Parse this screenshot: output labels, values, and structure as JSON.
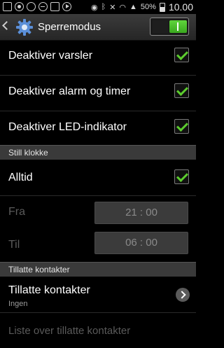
{
  "status_bar": {
    "icons": [
      "mail-icon",
      "camera-icon",
      "block-icon",
      "minus-icon",
      "image-icon",
      "play-icon",
      "eye-icon",
      "bluetooth-icon",
      "mute-icon",
      "wifi-icon",
      "signal-icon"
    ],
    "battery_percent": "50%",
    "time": "10.00"
  },
  "action_bar": {
    "title": "Sperremodus",
    "switch_on": true
  },
  "settings": {
    "items": [
      {
        "label": "Deaktiver varsler",
        "checked": true
      },
      {
        "label": "Deaktiver alarm og timer",
        "checked": true
      },
      {
        "label": "Deaktiver LED-indikator",
        "checked": true
      }
    ]
  },
  "clock_section": {
    "header": "Still klokke",
    "always_label": "Alltid",
    "always_checked": true,
    "from_label": "Fra",
    "from_time": "21 : 00",
    "to_label": "Til",
    "to_time": "06 : 00"
  },
  "contacts_section": {
    "header": "Tillatte kontakter",
    "allowed_label": "Tillatte kontakter",
    "allowed_value": "Ingen",
    "list_label": "Liste over tillatte kontakter"
  },
  "colors": {
    "accent_green": "#5ccc2e",
    "section_bg": "#3a3a3a",
    "disabled_text": "#5a5a5a"
  }
}
